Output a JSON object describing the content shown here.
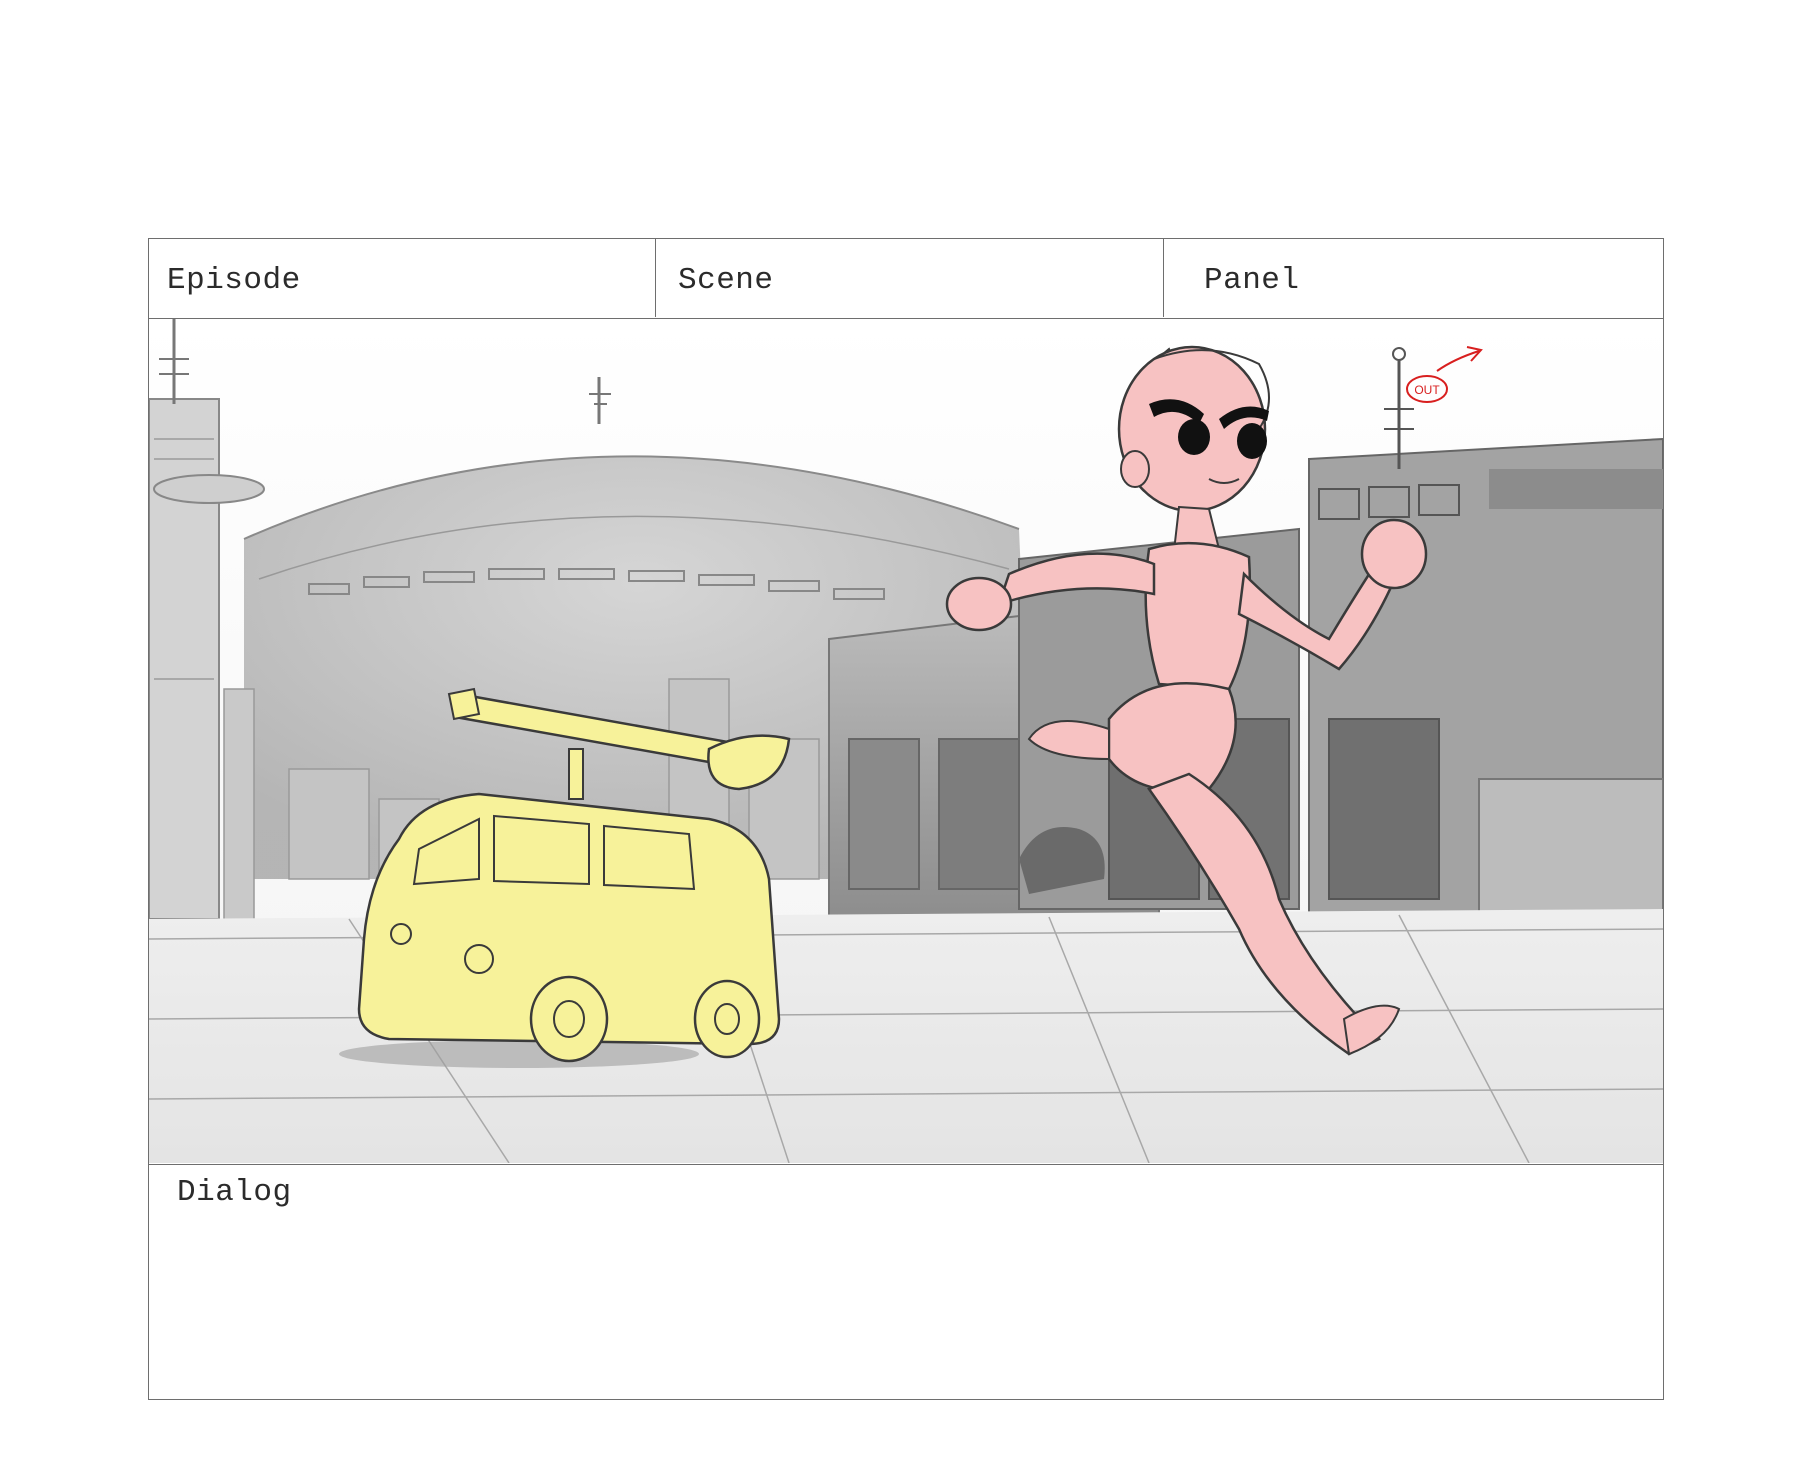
{
  "storyboard": {
    "header": {
      "episode_label": "Episode",
      "scene_label": "Scene",
      "panel_label": "Panel"
    },
    "dialog_label": "Dialog",
    "annotation": {
      "text": "OUT",
      "color": "#d81f1f"
    },
    "colors": {
      "character_fill": "#f7c2c2",
      "vehicle_fill": "#f7f29a",
      "background_tone": "#bdbdbd",
      "annotation": "#d81f1f"
    }
  }
}
